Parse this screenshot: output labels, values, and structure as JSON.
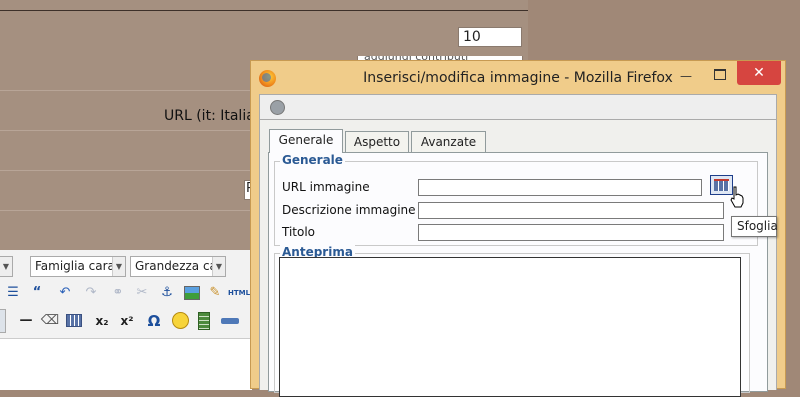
{
  "background": {
    "number_value": "10",
    "button_text": "aggiungi contributi",
    "url_label": "URL (it: Italia",
    "small_box_text": "P"
  },
  "editor": {
    "font_family_select": "Famiglia caratt",
    "font_size_select": "Grandezza car",
    "toolbar_row1": [
      "indent-icon",
      "blockquote-icon",
      "undo-icon",
      "redo-icon",
      "link-icon",
      "unlink-icon",
      "anchor-icon",
      "image-icon",
      "cleanup-icon",
      "html-icon"
    ],
    "html_label": "HTML",
    "toolbar_row2": [
      "hr-icon",
      "eraser-icon",
      "table-icon",
      "subscript-icon",
      "superscript-icon",
      "omega-icon",
      "smiley-icon",
      "media-icon",
      "separator-icon"
    ],
    "subscript_label": "x₂",
    "superscript_label": "x²",
    "omega_label": "Ω"
  },
  "firefox_window": {
    "title": "Inserisci/modifica immagine - Mozilla Firefox",
    "close_glyph": "✕",
    "minimize_glyph": "—",
    "tabs": [
      {
        "label": "Generale"
      },
      {
        "label": "Aspetto"
      },
      {
        "label": "Avanzate"
      }
    ],
    "general_section": {
      "legend": "Generale",
      "url_label": "URL immagine",
      "url_value": "",
      "description_label": "Descrizione immagine",
      "description_value": "",
      "title_label": "Titolo",
      "title_value": ""
    },
    "preview_section": {
      "legend": "Anteprima"
    },
    "browse_tooltip": "Sfoglia"
  },
  "colors": {
    "desktop_bg": "#a08877",
    "window_frame": "#f0cc8a",
    "close_button": "#d64540",
    "legend_text": "#2b5a94"
  }
}
